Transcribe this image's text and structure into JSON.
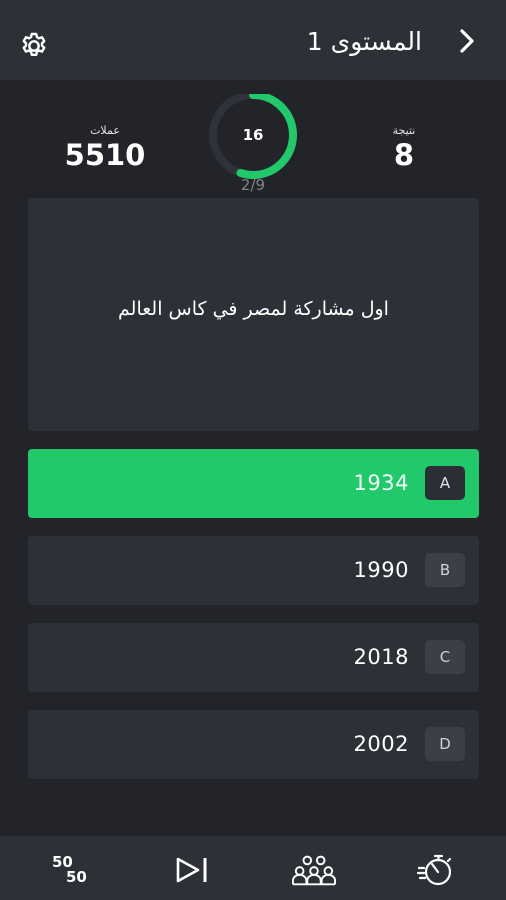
{
  "header": {
    "title": "المستوى 1",
    "back_icon": "chevron-right-icon",
    "settings_icon": "gear-icon"
  },
  "stats": {
    "coins_label": "عملات",
    "coins_value": "5510",
    "score_label": "نتيجة",
    "score_value": "8"
  },
  "timer": {
    "seconds": "16",
    "remaining_fraction": 0.55
  },
  "progress": "2/9",
  "question": {
    "text": "اول مشاركة لمصر في كاس العالم"
  },
  "options": [
    {
      "letter": "A",
      "text": "1934",
      "state": "correct"
    },
    {
      "letter": "B",
      "text": "1990",
      "state": "normal"
    },
    {
      "letter": "C",
      "text": "2018",
      "state": "normal"
    },
    {
      "letter": "D",
      "text": "2002",
      "state": "normal"
    }
  ],
  "tools": {
    "fifty_top": "50",
    "fifty_bottom": "50",
    "skip_icon": "skip-icon",
    "audience_icon": "audience-icon",
    "time_icon": "stopwatch-icon"
  },
  "colors": {
    "accent": "#22c96b",
    "background": "#222429",
    "surface": "#2d3036"
  }
}
